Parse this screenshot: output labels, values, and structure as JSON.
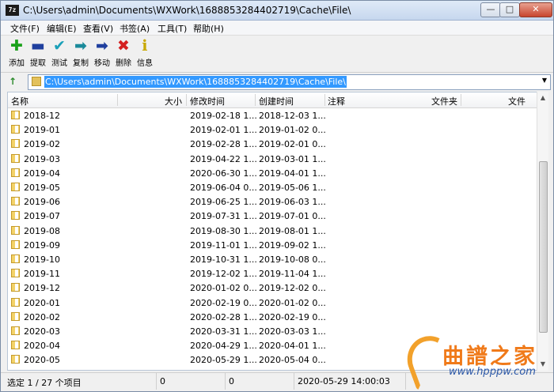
{
  "window": {
    "app_icon": "7z",
    "title": "C:\\Users\\admin\\Documents\\WXWork\\1688853284402719\\Cache\\File\\",
    "controls": {
      "minimize": "—",
      "maximize": "□",
      "close": "✕"
    }
  },
  "menu": [
    {
      "label": "文件(F)"
    },
    {
      "label": "编辑(E)"
    },
    {
      "label": "查看(V)"
    },
    {
      "label": "书签(A)"
    },
    {
      "label": "工具(T)"
    },
    {
      "label": "帮助(H)"
    }
  ],
  "toolbar": [
    {
      "label": "添加",
      "icon": "plus-icon",
      "glyph": "✚",
      "color": "#1aa11a"
    },
    {
      "label": "提取",
      "icon": "minus-icon",
      "glyph": "▬",
      "color": "#1f3f9e"
    },
    {
      "label": "测试",
      "icon": "checkmark-icon",
      "glyph": "✔",
      "color": "#1aa0b8"
    },
    {
      "label": "复制",
      "icon": "copy-arrow-icon",
      "glyph": "➡",
      "color": "#1a8a9a"
    },
    {
      "label": "移动",
      "icon": "move-arrow-icon",
      "glyph": "➡",
      "color": "#1f3f9e"
    },
    {
      "label": "删除",
      "icon": "delete-x-icon",
      "glyph": "✖",
      "color": "#d42020"
    },
    {
      "label": "信息",
      "icon": "info-icon",
      "glyph": "ℹ",
      "color": "#c8a800"
    }
  ],
  "address": {
    "up_icon": "up-folder-icon",
    "up_glyph": "↑",
    "path": "C:\\Users\\admin\\Documents\\WXWork\\1688853284402719\\Cache\\File\\",
    "dropdown_glyph": "▼"
  },
  "columns": [
    "名称",
    "大小",
    "修改时间",
    "创建时间",
    "注释",
    "文件夹",
    "文件"
  ],
  "rows": [
    {
      "name": "2018-12",
      "modified": "2019-02-18 1...",
      "created": "2018-12-03 1..."
    },
    {
      "name": "2019-01",
      "modified": "2019-02-01 1...",
      "created": "2019-01-02 0..."
    },
    {
      "name": "2019-02",
      "modified": "2019-02-28 1...",
      "created": "2019-02-01 0..."
    },
    {
      "name": "2019-03",
      "modified": "2019-04-22 1...",
      "created": "2019-03-01 1..."
    },
    {
      "name": "2019-04",
      "modified": "2020-06-30 1...",
      "created": "2019-04-01 1..."
    },
    {
      "name": "2019-05",
      "modified": "2019-06-04 0...",
      "created": "2019-05-06 1..."
    },
    {
      "name": "2019-06",
      "modified": "2019-06-25 1...",
      "created": "2019-06-03 1..."
    },
    {
      "name": "2019-07",
      "modified": "2019-07-31 1...",
      "created": "2019-07-01 0..."
    },
    {
      "name": "2019-08",
      "modified": "2019-08-30 1...",
      "created": "2019-08-01 1..."
    },
    {
      "name": "2019-09",
      "modified": "2019-11-01 1...",
      "created": "2019-09-02 1..."
    },
    {
      "name": "2019-10",
      "modified": "2019-10-31 1...",
      "created": "2019-10-08 0..."
    },
    {
      "name": "2019-11",
      "modified": "2019-12-02 1...",
      "created": "2019-11-04 1..."
    },
    {
      "name": "2019-12",
      "modified": "2020-01-02 0...",
      "created": "2019-12-02 0..."
    },
    {
      "name": "2020-01",
      "modified": "2020-02-19 0...",
      "created": "2020-01-02 0..."
    },
    {
      "name": "2020-02",
      "modified": "2020-02-28 1...",
      "created": "2020-02-19 0..."
    },
    {
      "name": "2020-03",
      "modified": "2020-03-31 1...",
      "created": "2020-03-03 1..."
    },
    {
      "name": "2020-04",
      "modified": "2020-04-29 1...",
      "created": "2020-04-01 1..."
    },
    {
      "name": "2020-05",
      "modified": "2020-05-29 1...",
      "created": "2020-05-04 0..."
    }
  ],
  "status": {
    "selection": "选定 1 / 27 个项目",
    "size1": "0",
    "size2": "0",
    "datetime": "2020-05-29 14:00:03"
  },
  "watermark": {
    "brand": "曲譜之家",
    "url": "www.hpppw.com",
    "brand_color": "#f07a1a",
    "url_color": "#2c58a8"
  }
}
